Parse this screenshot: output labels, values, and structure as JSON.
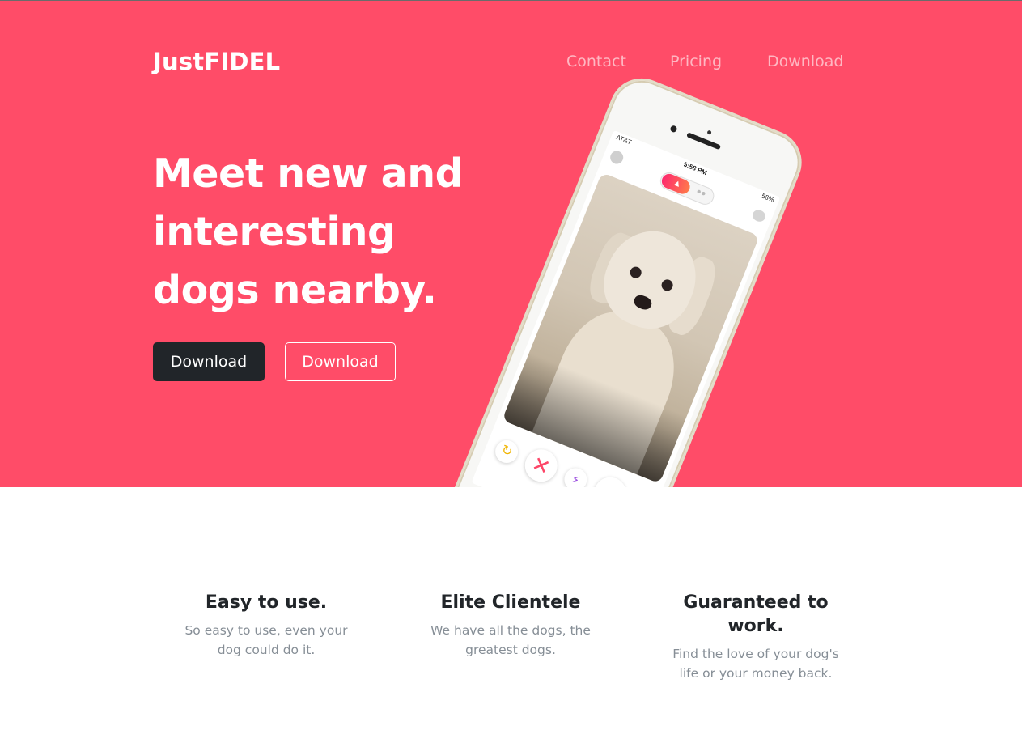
{
  "brand": "JustFIDEL",
  "nav": {
    "items": [
      "Contact",
      "Pricing",
      "Download"
    ]
  },
  "hero": {
    "headline_lines": [
      "Meet new and",
      "interesting",
      "dogs nearby."
    ],
    "primary_button": "Download",
    "secondary_button": "Download",
    "background_color": "#ff4c68"
  },
  "phone": {
    "status_left": "AT&T",
    "status_time": "5:58 PM",
    "status_right": "58%"
  },
  "features": [
    {
      "title": "Easy to use.",
      "text_lines": [
        "So easy to use, even your",
        "dog could do it."
      ]
    },
    {
      "title": "Elite Clientele",
      "text_lines": [
        "We have all the dogs, the",
        "greatest dogs."
      ]
    },
    {
      "title_lines": [
        "Guaranteed to",
        "work."
      ],
      "text_lines": [
        "Find the love of your dog's",
        "life or your money back."
      ]
    }
  ]
}
